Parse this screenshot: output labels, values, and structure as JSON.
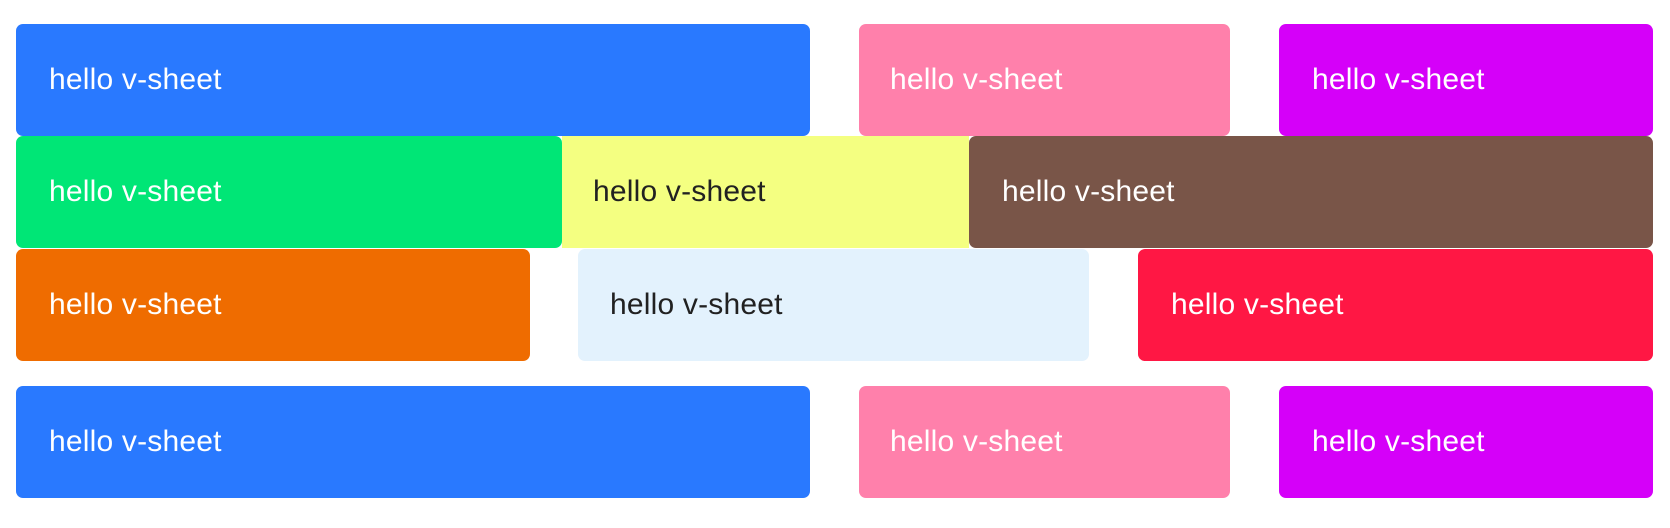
{
  "sheets": {
    "row1": [
      {
        "label": "hello v-sheet",
        "color": "#2979FF",
        "text_color": "#FFFFFF"
      },
      {
        "label": "hello v-sheet",
        "color": "#FF80AB",
        "text_color": "#FFFFFF"
      },
      {
        "label": "hello v-sheet",
        "color": "#D500F9",
        "text_color": "#FFFFFF"
      }
    ],
    "row2": [
      {
        "label": "hello v-sheet",
        "color": "#00E676",
        "text_color": "#FFFFFF"
      },
      {
        "label": "hello v-sheet",
        "color": "#F4FF81",
        "text_color": "#212121"
      },
      {
        "label": "hello v-sheet",
        "color": "#795548",
        "text_color": "#FFFFFF"
      }
    ],
    "row3": [
      {
        "label": "hello v-sheet",
        "color": "#EF6C00",
        "text_color": "#FFFFFF"
      },
      {
        "label": "hello v-sheet",
        "color": "#E3F2FD",
        "text_color": "#212121"
      },
      {
        "label": "hello v-sheet",
        "color": "#FF1744",
        "text_color": "#FFFFFF"
      }
    ],
    "row4": [
      {
        "label": "hello v-sheet",
        "color": "#2979FF",
        "text_color": "#FFFFFF"
      },
      {
        "label": "hello v-sheet",
        "color": "#FF80AB",
        "text_color": "#FFFFFF"
      },
      {
        "label": "hello v-sheet",
        "color": "#D500F9",
        "text_color": "#FFFFFF"
      }
    ]
  }
}
